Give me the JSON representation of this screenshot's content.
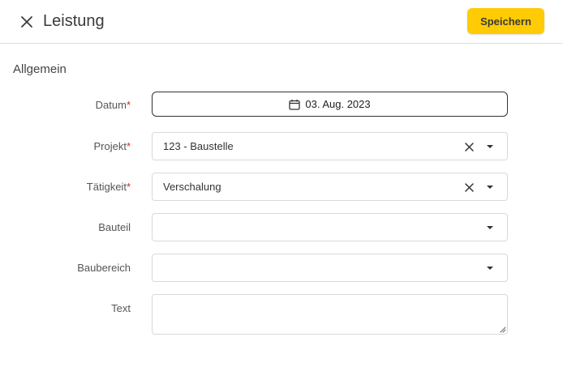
{
  "header": {
    "title": "Leistung",
    "save_label": "Speichern",
    "accent_color": "#fecb05"
  },
  "section": {
    "title": "Allgemein"
  },
  "form": {
    "datum": {
      "label": "Datum",
      "required": "*",
      "value": "03. Aug. 2023",
      "icon": "calendar-icon"
    },
    "projekt": {
      "label": "Projekt",
      "required": "*",
      "value": "123 - Baustelle"
    },
    "taetigkeit": {
      "label": "Tätigkeit",
      "required": "*",
      "value": "Verschalung"
    },
    "bauteil": {
      "label": "Bauteil",
      "value": ""
    },
    "baubereich": {
      "label": "Baubereich",
      "value": ""
    },
    "text": {
      "label": "Text",
      "value": ""
    }
  },
  "colors": {
    "required": "#c62828",
    "border": "#d9d9d9"
  }
}
